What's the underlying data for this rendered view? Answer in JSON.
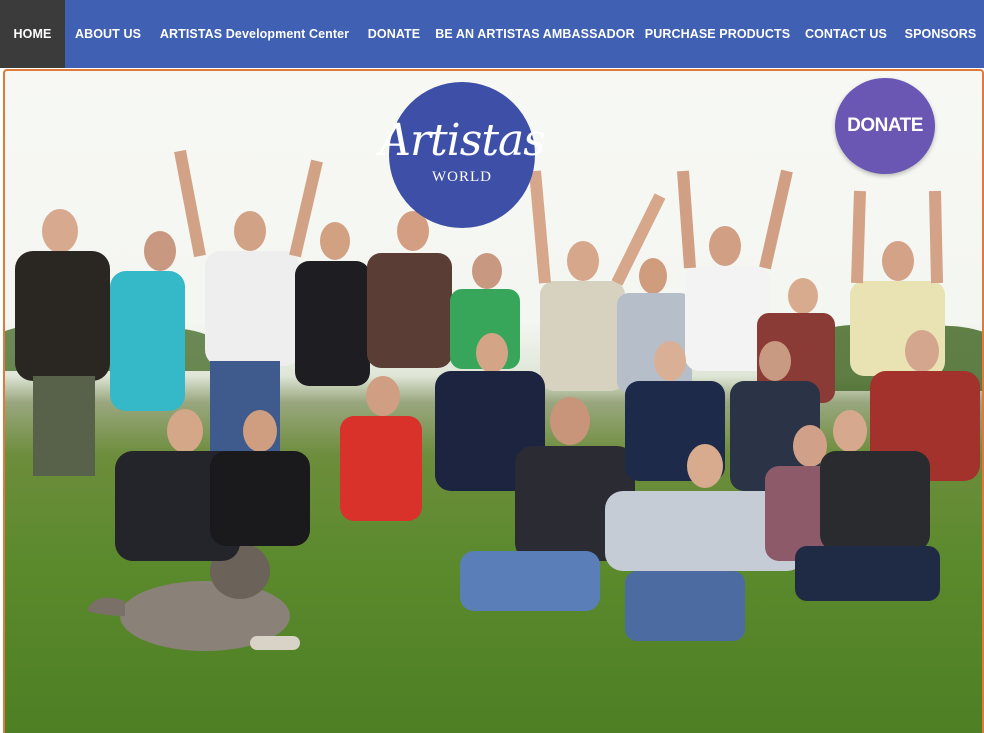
{
  "nav": {
    "items": [
      {
        "label": "HOME",
        "active": true
      },
      {
        "label": "ABOUT US"
      },
      {
        "label": "ARTISTAS Development Center"
      },
      {
        "label": "DONATE"
      },
      {
        "label": "BE AN ARTISTAS AMBASSADOR"
      },
      {
        "label": "PURCHASE PRODUCTS"
      },
      {
        "label": "CONTACT US"
      },
      {
        "label": "SPONSORS"
      }
    ]
  },
  "hero": {
    "logo_main": "Artistas",
    "logo_sub": "WORLD",
    "donate_label": "DONATE",
    "photo_description_icon": "group-photo-image"
  },
  "colors": {
    "nav_bg": "#4060b3",
    "nav_active_bg": "#3b3b3b",
    "logo_bg": "#3d4fa6",
    "donate_bg": "#6a56b3",
    "hero_border": "#e07a3a"
  }
}
